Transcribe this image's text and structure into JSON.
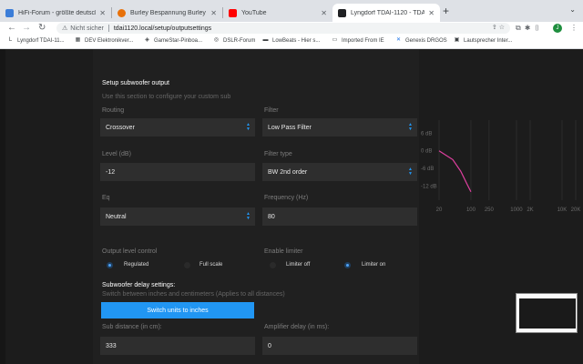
{
  "browser": {
    "tabs": [
      {
        "title": "HiFi-Forum - größte deutsche H",
        "fav_color": "#3b7dd8",
        "active": false
      },
      {
        "title": "Burley Bespannung Burley Enc",
        "fav_color": "#e8710a",
        "active": false
      },
      {
        "title": "YouTube",
        "fav_color": "#ff0000",
        "active": false
      },
      {
        "title": "Lyngdorf TDAI-1120 - TDAI-11",
        "fav_color": "#202124",
        "active": true
      }
    ],
    "new_tab": "+",
    "tab_menu": "⌄",
    "nav": {
      "back": "←",
      "forward": "→",
      "reload": "↻"
    },
    "security_label": "Nicht sicher",
    "url": "tdai1120.local/setup/outputsettings",
    "avatar_letter": "J",
    "bookmarks": [
      {
        "label": "Lyngdorf TDAI-11...",
        "icon": "L"
      },
      {
        "label": "DEV Elektronikver...",
        "icon": "▦"
      },
      {
        "label": "GameStar-Pinboa...",
        "icon": "◈"
      },
      {
        "label": "DSLR-Forum",
        "icon": "◎"
      },
      {
        "label": "LowBeats - Hier s...",
        "icon": "▬"
      },
      {
        "label": "Imported From IE",
        "icon": "▭"
      },
      {
        "label": "Genexis DRGOS",
        "icon": "✕"
      },
      {
        "label": "Lautsprecher Inter...",
        "icon": "▣"
      }
    ]
  },
  "page": {
    "title": "Setup subwoofer output",
    "subtitle": "Use this section to configure your custom sub",
    "routing": {
      "label": "Routing",
      "value": "Crossover"
    },
    "filter": {
      "label": "Filter",
      "value": "Low Pass Filter"
    },
    "level": {
      "label": "Level (dB)",
      "value": "-12"
    },
    "filter_type": {
      "label": "Filter type",
      "value": "BW 2nd order"
    },
    "eq": {
      "label": "Eq",
      "value": "Neutral"
    },
    "frequency": {
      "label": "Frequency (Hz)",
      "value": "80"
    },
    "output_level_control": {
      "label": "Output level control",
      "options": [
        {
          "label": "Regulated",
          "selected": true
        },
        {
          "label": "Full scale",
          "selected": false
        }
      ]
    },
    "enable_limiter": {
      "label": "Enable limiter",
      "options": [
        {
          "label": "Limiter off",
          "selected": false
        },
        {
          "label": "Limiter on",
          "selected": true
        }
      ]
    },
    "delay": {
      "title": "Subwoofer delay settings:",
      "subtitle": "Switch between inches and centimeters (Applies to all distances)",
      "switch_button": "Switch units to inches",
      "sub_distance": {
        "label": "Sub distance (in cm):",
        "value": "333"
      },
      "amplifier_delay": {
        "label": "Amplifier delay (in ms):",
        "value": "0"
      }
    }
  },
  "chart_data": {
    "type": "line",
    "xscale": "log",
    "xlim": [
      20,
      20000
    ],
    "ylim": [
      -15,
      8
    ],
    "y_ticks": [
      "6 dB",
      "0 dB",
      "-6 dB",
      "-12 dB"
    ],
    "x_ticks": [
      "20",
      "100",
      "250",
      "1000",
      "2K",
      "10K",
      "20K"
    ],
    "series": [
      {
        "color": "#e040a0",
        "x": [
          20,
          40,
          60,
          80,
          100
        ],
        "y": [
          0,
          -3,
          -7,
          -11,
          -14
        ]
      }
    ]
  }
}
